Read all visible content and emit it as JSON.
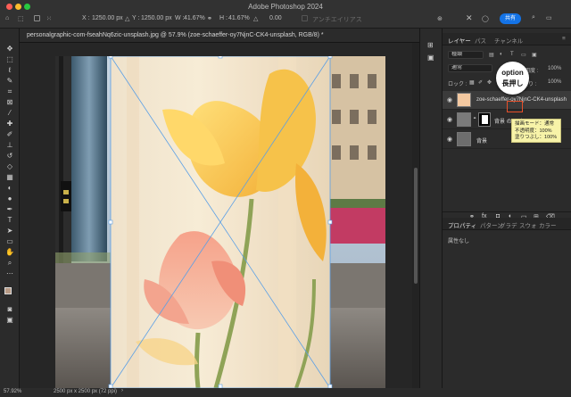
{
  "app": {
    "title": "Adobe Photoshop 2024"
  },
  "options_bar": {
    "x_label": "X :",
    "x_value": "1250.00 px",
    "y_label": "Y :",
    "y_value": "1250.00 px",
    "w_label": "W :",
    "w_value": "41.67%",
    "h_label": "H :",
    "h_value": "41.67%",
    "angle_value": "0.00",
    "anti_alias_label": "アンチエイリアス",
    "share_label": "共有"
  },
  "document": {
    "tab_label": "personalgraphic-com-fseahNq6zic-unsplash.jpg @ 57.9% (zoe-schaeffer-oy7NjnC-CK4-unsplash, RGB/8) *"
  },
  "status_bar": {
    "zoom": "57.92%",
    "doc_size": "2500 px x 2500 px (72 ppi)"
  },
  "layers_panel": {
    "tabs": [
      "レイヤー",
      "パス",
      "チャンネル"
    ],
    "active_tab": "レイヤー",
    "search_placeholder": "種類",
    "blend_mode": "通常",
    "opacity_label": "不透明度 :",
    "opacity_value": "100%",
    "lock_label": "ロック :",
    "fill_label": "塗り :",
    "fill_value": "100%",
    "layers": [
      {
        "name": "zoe-schaeffer-oy7NjnC-CK4-unsplash"
      },
      {
        "name": "背景 のコピー"
      },
      {
        "name": "背景"
      }
    ]
  },
  "callout": {
    "line1": "option",
    "line2": "長押し"
  },
  "tooltip": {
    "line1": "描画モード：通常",
    "line2": "不透明度：100%",
    "line3": "塗りつぶし：100%"
  },
  "properties_panel": {
    "tabs": [
      "プロパティ",
      "パターン",
      "グラデ",
      "スウォ",
      "カラー"
    ],
    "active_tab": "プロパティ",
    "content": "属性なし"
  },
  "colors": {
    "accent": "#1473e6",
    "highlight_box": "#e8502a",
    "tooltip_bg": "#f7f3a8",
    "transform_line": "#5a9fe6"
  },
  "icons": {
    "tools": [
      "move-icon",
      "marquee-icon",
      "lasso-icon",
      "quick-select-icon",
      "crop-icon",
      "frame-icon",
      "eyedropper-icon",
      "healing-icon",
      "brush-icon",
      "stamp-icon",
      "history-brush-icon",
      "eraser-icon",
      "gradient-icon",
      "blur-icon",
      "dodge-icon",
      "pen-icon",
      "type-icon",
      "path-select-icon",
      "rectangle-icon",
      "hand-icon",
      "zoom-icon",
      "more-icon",
      "color-swatch-icon",
      "quick-mask-icon",
      "screen-mode-icon"
    ]
  }
}
